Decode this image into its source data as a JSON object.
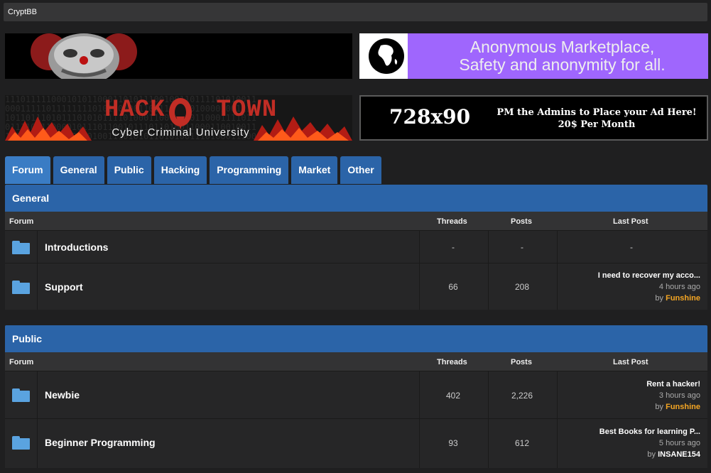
{
  "app": {
    "title": "CryptBB"
  },
  "banners": {
    "market_line1": "Anonymous Marketplace,",
    "market_line2": "Safety and anonymity for all.",
    "hack_title_1": "HACK",
    "hack_title_2": "TOWN",
    "hack_sub": "Cyber Criminal University",
    "ad_size": "728x90",
    "ad_line1": "PM the Admins to Place your Ad Here!",
    "ad_line2": "20$ Per Month"
  },
  "tabs": [
    {
      "label": "Forum"
    },
    {
      "label": "General"
    },
    {
      "label": "Public"
    },
    {
      "label": "Hacking"
    },
    {
      "label": "Programming"
    },
    {
      "label": "Market"
    },
    {
      "label": "Other"
    }
  ],
  "columns": {
    "forum": "Forum",
    "threads": "Threads",
    "posts": "Posts",
    "last_post": "Last Post"
  },
  "sections": [
    {
      "title": "General",
      "forums": [
        {
          "name": "Introductions",
          "threads": "-",
          "posts": "-",
          "last_post": "-"
        },
        {
          "name": "Support",
          "threads": "66",
          "posts": "208",
          "last_title": "I need to recover my acco...",
          "last_time": "4 hours ago",
          "by": "by",
          "last_user": "Funshine"
        }
      ]
    },
    {
      "title": "Public",
      "forums": [
        {
          "name": "Newbie",
          "threads": "402",
          "posts": "2,226",
          "last_title": "Rent a hacker!",
          "last_time": "3 hours ago",
          "by": "by",
          "last_user": "Funshine"
        },
        {
          "name": "Beginner Programming",
          "threads": "93",
          "posts": "612",
          "last_title": "Best Books for learning P...",
          "last_time": "5 hours ago",
          "by": "by",
          "last_user": "INSANE154"
        }
      ]
    }
  ],
  "colors": {
    "tab_blue": "#2b64a8",
    "tab_active": "#3a7cc4",
    "folder_blue": "#5aa3e0",
    "username_orange": "#f5a623",
    "market_purple": "#9f66fd",
    "hack_red": "#c12d25"
  }
}
